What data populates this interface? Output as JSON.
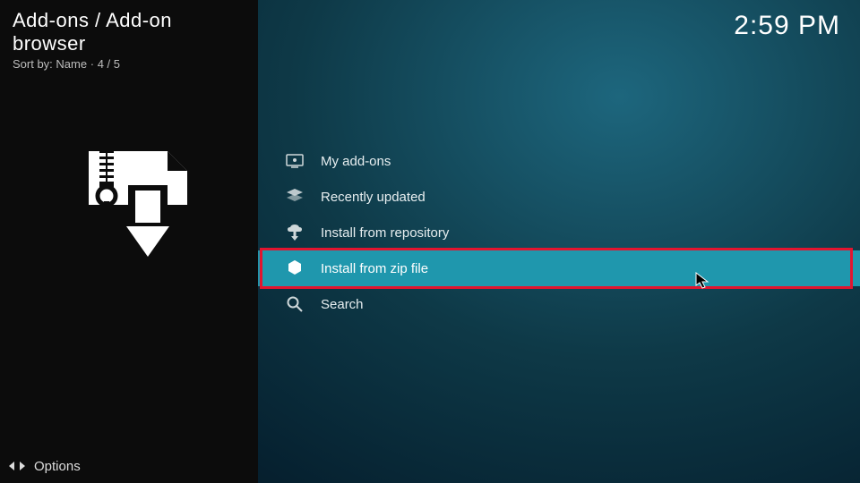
{
  "header": {
    "breadcrumb": "Add-ons / Add-on browser",
    "sort_label": "Sort by:",
    "sort_value": "Name",
    "position": "4 / 5"
  },
  "clock": "2:59 PM",
  "menu": {
    "items": [
      {
        "icon": "my-addons-icon",
        "label": "My add-ons",
        "selected": false
      },
      {
        "icon": "recently-updated-icon",
        "label": "Recently updated",
        "selected": false
      },
      {
        "icon": "install-repo-icon",
        "label": "Install from repository",
        "selected": false
      },
      {
        "icon": "install-zip-icon",
        "label": "Install from zip file",
        "selected": true
      },
      {
        "icon": "search-icon",
        "label": "Search",
        "selected": false
      }
    ]
  },
  "footer": {
    "options_label": "Options"
  }
}
